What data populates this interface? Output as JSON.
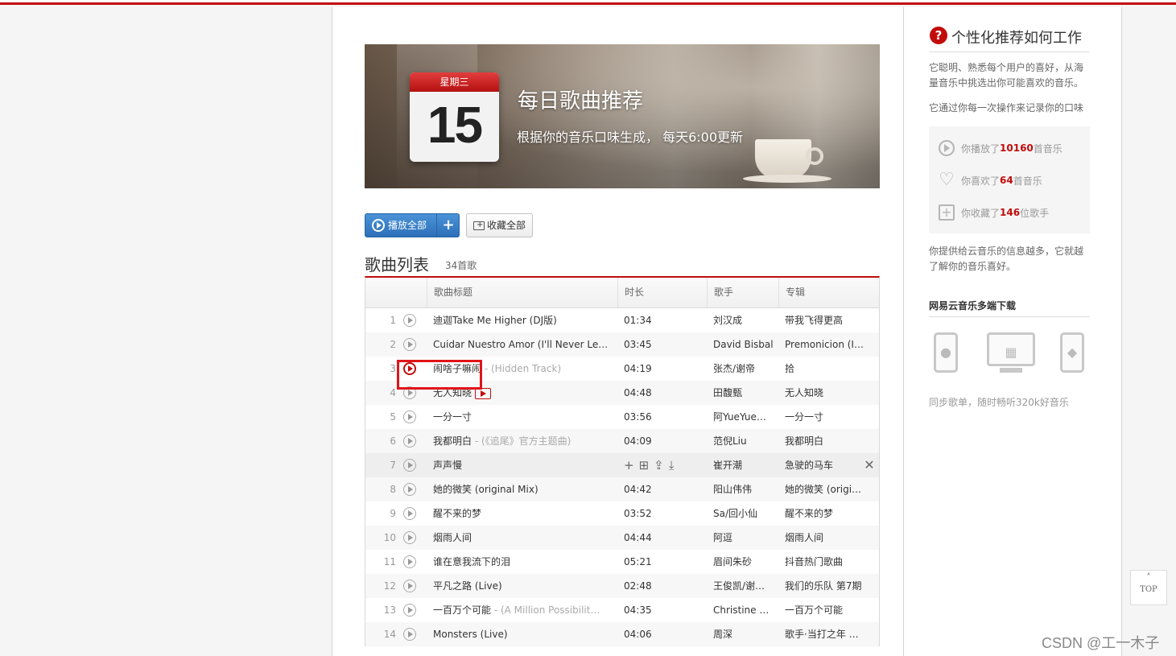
{
  "banner": {
    "weekday": "星期三",
    "day": "15",
    "title": "每日歌曲推荐",
    "subtitle": "根据你的音乐口味生成， 每天6:00更新"
  },
  "actions": {
    "play_all": "播放全部",
    "add": "+",
    "collect_all": "收藏全部"
  },
  "list": {
    "title": "歌曲列表",
    "count": "34首歌",
    "headers": [
      "",
      "歌曲标题",
      "时长",
      "歌手",
      "专辑"
    ],
    "rows": [
      {
        "num": "1",
        "title": "迪迦Take Me Higher (DJ版)",
        "alias": "",
        "mv": false,
        "time": "01:34",
        "artist": "刘汉成",
        "album": "带我飞得更高"
      },
      {
        "num": "2",
        "title": "Cuidar Nuestro Amor (I'll Never Le…",
        "alias": "",
        "mv": true,
        "time": "03:45",
        "artist": "David Bisbal",
        "album": "Premonicion (In…"
      },
      {
        "num": "3",
        "title": "闹啥子嘛闹",
        "alias": " - (Hidden Track)",
        "mv": false,
        "time": "04:19",
        "artist": "张杰/谢帝",
        "album": "拾"
      },
      {
        "num": "4",
        "title": "无人知晓",
        "alias": "",
        "mv": true,
        "time": "04:48",
        "artist": "田馥甄",
        "album": "无人知晓"
      },
      {
        "num": "5",
        "title": "一分一寸",
        "alias": "",
        "mv": false,
        "time": "03:56",
        "artist": "阿YueYue…",
        "album": "一分一寸"
      },
      {
        "num": "6",
        "title": "我都明白",
        "alias": " - (《追尾》官方主题曲)",
        "mv": false,
        "time": "04:09",
        "artist": "范倪Liu",
        "album": "我都明白"
      },
      {
        "num": "7",
        "title": "声声慢",
        "alias": "",
        "mv": false,
        "time": "",
        "artist": "崔开潮",
        "album": "急驶的马车"
      },
      {
        "num": "8",
        "title": "她的微笑 (original Mix)",
        "alias": "",
        "mv": false,
        "time": "04:42",
        "artist": "阳山伟伟",
        "album": "她的微笑 (origi…"
      },
      {
        "num": "9",
        "title": "醒不来的梦",
        "alias": "",
        "mv": false,
        "time": "03:52",
        "artist": "Sa/回小仙",
        "album": "醒不来的梦"
      },
      {
        "num": "10",
        "title": "烟雨人间",
        "alias": "",
        "mv": false,
        "time": "04:44",
        "artist": "阿逗",
        "album": "烟雨人间"
      },
      {
        "num": "11",
        "title": "谁在意我流下的泪",
        "alias": "",
        "mv": false,
        "time": "05:21",
        "artist": "眉间朱砂",
        "album": "抖音热门歌曲"
      },
      {
        "num": "12",
        "title": "平凡之路 (Live)",
        "alias": "",
        "mv": false,
        "time": "02:48",
        "artist": "王俊凯/谢…",
        "album": "我们的乐队 第7期"
      },
      {
        "num": "13",
        "title": "一百万个可能",
        "alias": " - (A Million Possibilit…",
        "mv": false,
        "time": "04:35",
        "artist": "Christine …",
        "album": "一百万个可能"
      },
      {
        "num": "14",
        "title": "Monsters (Live)",
        "alias": "",
        "mv": false,
        "time": "04:06",
        "artist": "周深",
        "album": "歌手·当打之年 …"
      }
    ]
  },
  "sidebar": {
    "how_title": "个性化推荐如何工作",
    "desc1": "它聪明、熟悉每个用户的喜好，从海量音乐中挑选出你可能喜欢的音乐。",
    "desc2": "它通过你每一次操作来记录你的口味",
    "stat_play_pre": "你播放了",
    "stat_play_num": "10160",
    "stat_play_post": "首音乐",
    "stat_like_pre": "你喜欢了",
    "stat_like_num": "64",
    "stat_like_post": "首音乐",
    "stat_fav_pre": "你收藏了",
    "stat_fav_num": "146",
    "stat_fav_post": "位歌手",
    "desc3": "你提供给云音乐的信息越多，它就越了解你的音乐喜好。",
    "download_title": "网易云音乐多端下载",
    "sync": "同步歌单，随时畅听320k好音乐"
  },
  "top_button": "TOP",
  "watermark": "CSDN @工一木子",
  "colors": {
    "accent": "#c20c0c",
    "play_button": "#2b6fb8"
  }
}
